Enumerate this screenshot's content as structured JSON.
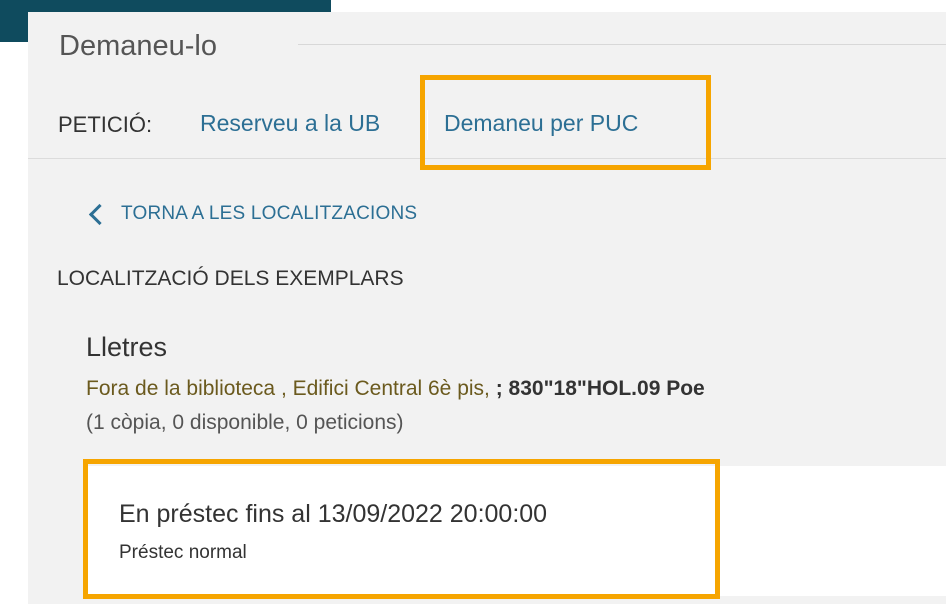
{
  "section": {
    "title": "Demaneu-lo"
  },
  "request": {
    "label": "PETICIÓ:",
    "options": [
      "Reserveu a la UB",
      "Demaneu per PUC"
    ]
  },
  "back_link": {
    "label": "TORNA A LES LOCALITZACIONS",
    "icon": "chevron-left-icon"
  },
  "locations": {
    "heading": "LOCALITZACIÓ DELS EXEMPLARS",
    "library": {
      "name": "Lletres",
      "location_text": "Fora de la biblioteca , Edifici Central 6è pis, ",
      "call_number": "; 830\"18\"HOL.09 Poe",
      "copies": "(1 còpia, 0 disponible, 0 peticions)"
    }
  },
  "item": {
    "status": "En préstec fins al 13/09/2022 20:00:00",
    "policy": "Préstec normal"
  },
  "colors": {
    "accent_dark": "#0f4b5e",
    "link": "#2c6f94",
    "highlight": "#f6a500"
  }
}
